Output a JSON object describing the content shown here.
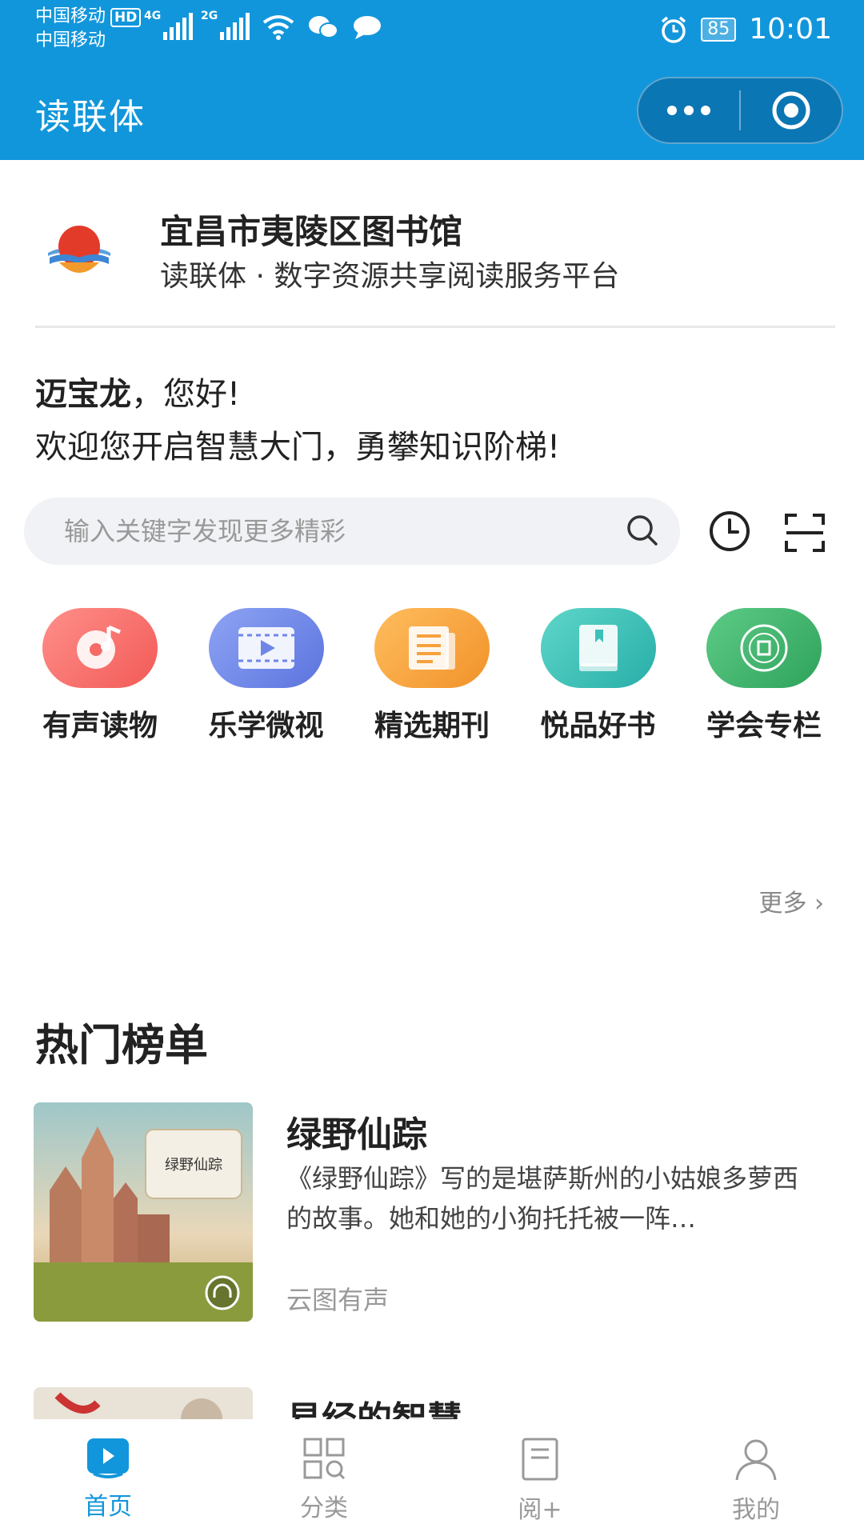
{
  "status_bar": {
    "carrier_1": "中国移动",
    "carrier_2": "中国移动",
    "hd_badge": "HD",
    "network_1": "4G",
    "network_2": "2G",
    "battery": "85",
    "time": "10:01"
  },
  "header": {
    "title": "读联体",
    "more_icon": "more-dots-icon",
    "close_icon": "target-circle-icon"
  },
  "library": {
    "name": "宜昌市夷陵区图书馆",
    "subtitle": "读联体 · 数字资源共享阅读服务平台"
  },
  "greeting": {
    "user": "迈宝龙",
    "hello": "，您好!",
    "message": "欢迎您开启智慧大门，勇攀知识阶梯!"
  },
  "search": {
    "placeholder": "输入关键字发现更多精彩",
    "value": ""
  },
  "categories": [
    {
      "label": "有声读物",
      "icon": "audio-disc-icon",
      "color": "#f8716e"
    },
    {
      "label": "乐学微视",
      "icon": "video-icon",
      "color": "#6f86e8"
    },
    {
      "label": "精选期刊",
      "icon": "newspaper-icon",
      "color": "#f6a23c"
    },
    {
      "label": "悦品好书",
      "icon": "book-icon",
      "color": "#3cc1b9"
    },
    {
      "label": "学会专栏",
      "icon": "seal-icon",
      "color": "#3cb46a"
    }
  ],
  "more_link": "更多",
  "hot_list": {
    "title": "热门榜单",
    "books": [
      {
        "title": "绿野仙踪",
        "description": "《绿野仙踪》写的是堪萨斯州的小姑娘多萝西的故事。她和她的小狗托托被一阵…",
        "source": "云图有声",
        "cover_text": "绿野仙踪"
      },
      {
        "title": "易经的智慧",
        "description": "",
        "source": ""
      }
    ]
  },
  "tabbar": {
    "tabs": [
      {
        "label": "首页",
        "icon": "home-book-icon",
        "active": true
      },
      {
        "label": "分类",
        "icon": "category-grid-icon",
        "active": false
      },
      {
        "label": "阅+",
        "icon": "document-icon",
        "active": false
      },
      {
        "label": "我的",
        "icon": "user-icon",
        "active": false
      }
    ]
  },
  "colors": {
    "primary": "#1296db",
    "text": "#222222",
    "muted": "#999999"
  }
}
